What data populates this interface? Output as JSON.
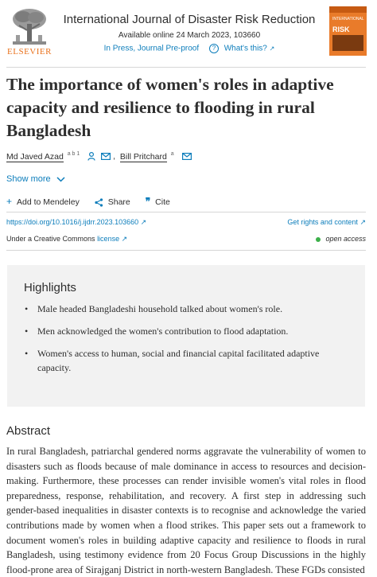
{
  "header": {
    "publisher_logo_text": "ELSEVIER",
    "journal_title": "International Journal of Disaster Risk Reduction",
    "available_online": "Available online 24 March 2023, 103660",
    "status": "In Press, Journal Pre-proof",
    "whats_this": "What's this?",
    "cover_small": "INTERNATIONAL JOURNAL OF DISASTER",
    "cover_big": "RISK"
  },
  "article": {
    "title": "The importance of women's roles in adaptive capacity and resilience to flooding in rural Bangladesh",
    "authors": [
      {
        "name": "Md Javed Azad",
        "affiliations": "a b 1"
      },
      {
        "name": "Bill Pritchard",
        "affiliations": "a"
      }
    ],
    "author_separator": ",",
    "show_more": "Show more",
    "actions": {
      "add_to_mendeley": "Add to Mendeley",
      "share": "Share",
      "cite": "Cite"
    },
    "doi": "https://doi.org/10.1016/j.ijdrr.2023.103660",
    "rights": "Get rights and content",
    "license_prefix": "Under a Creative Commons",
    "license_link": "license",
    "open_access": "open access"
  },
  "highlights": {
    "title": "Highlights",
    "items": [
      "Male headed Bangladeshi household talked about women's role.",
      "Men acknowledged the women's contribution to flood adaptation.",
      "Women's access to human, social and financial capital facilitated adaptive capacity."
    ]
  },
  "abstract": {
    "title": "Abstract",
    "text": "In rural Bangladesh, patriarchal gendered norms aggravate the vulnerability of women to disasters such as floods because of male dominance in access to resources and decision-making. Furthermore, these processes can render invisible women's vital roles in flood preparedness, response, rehabilitation, and recovery. A first step in addressing such gender-based inequalities in disaster contexts is to recognise and acknowledge the varied contributions made by women when a flood strikes. This paper sets out a framework to document women's roles in building adaptive capacity and resilience to floods in rural Bangladesh, using testimony evidence from 20 Focus Group Discussions in the highly flood-prone area of Sirajganj District in north-western Bangladesh. These FGDs consisted"
  },
  "colors": {
    "link": "#0c7dbb",
    "elsevier_orange": "#e9711c",
    "open_access_green": "#3cb04a",
    "highlights_bg": "#f2f2f2"
  }
}
